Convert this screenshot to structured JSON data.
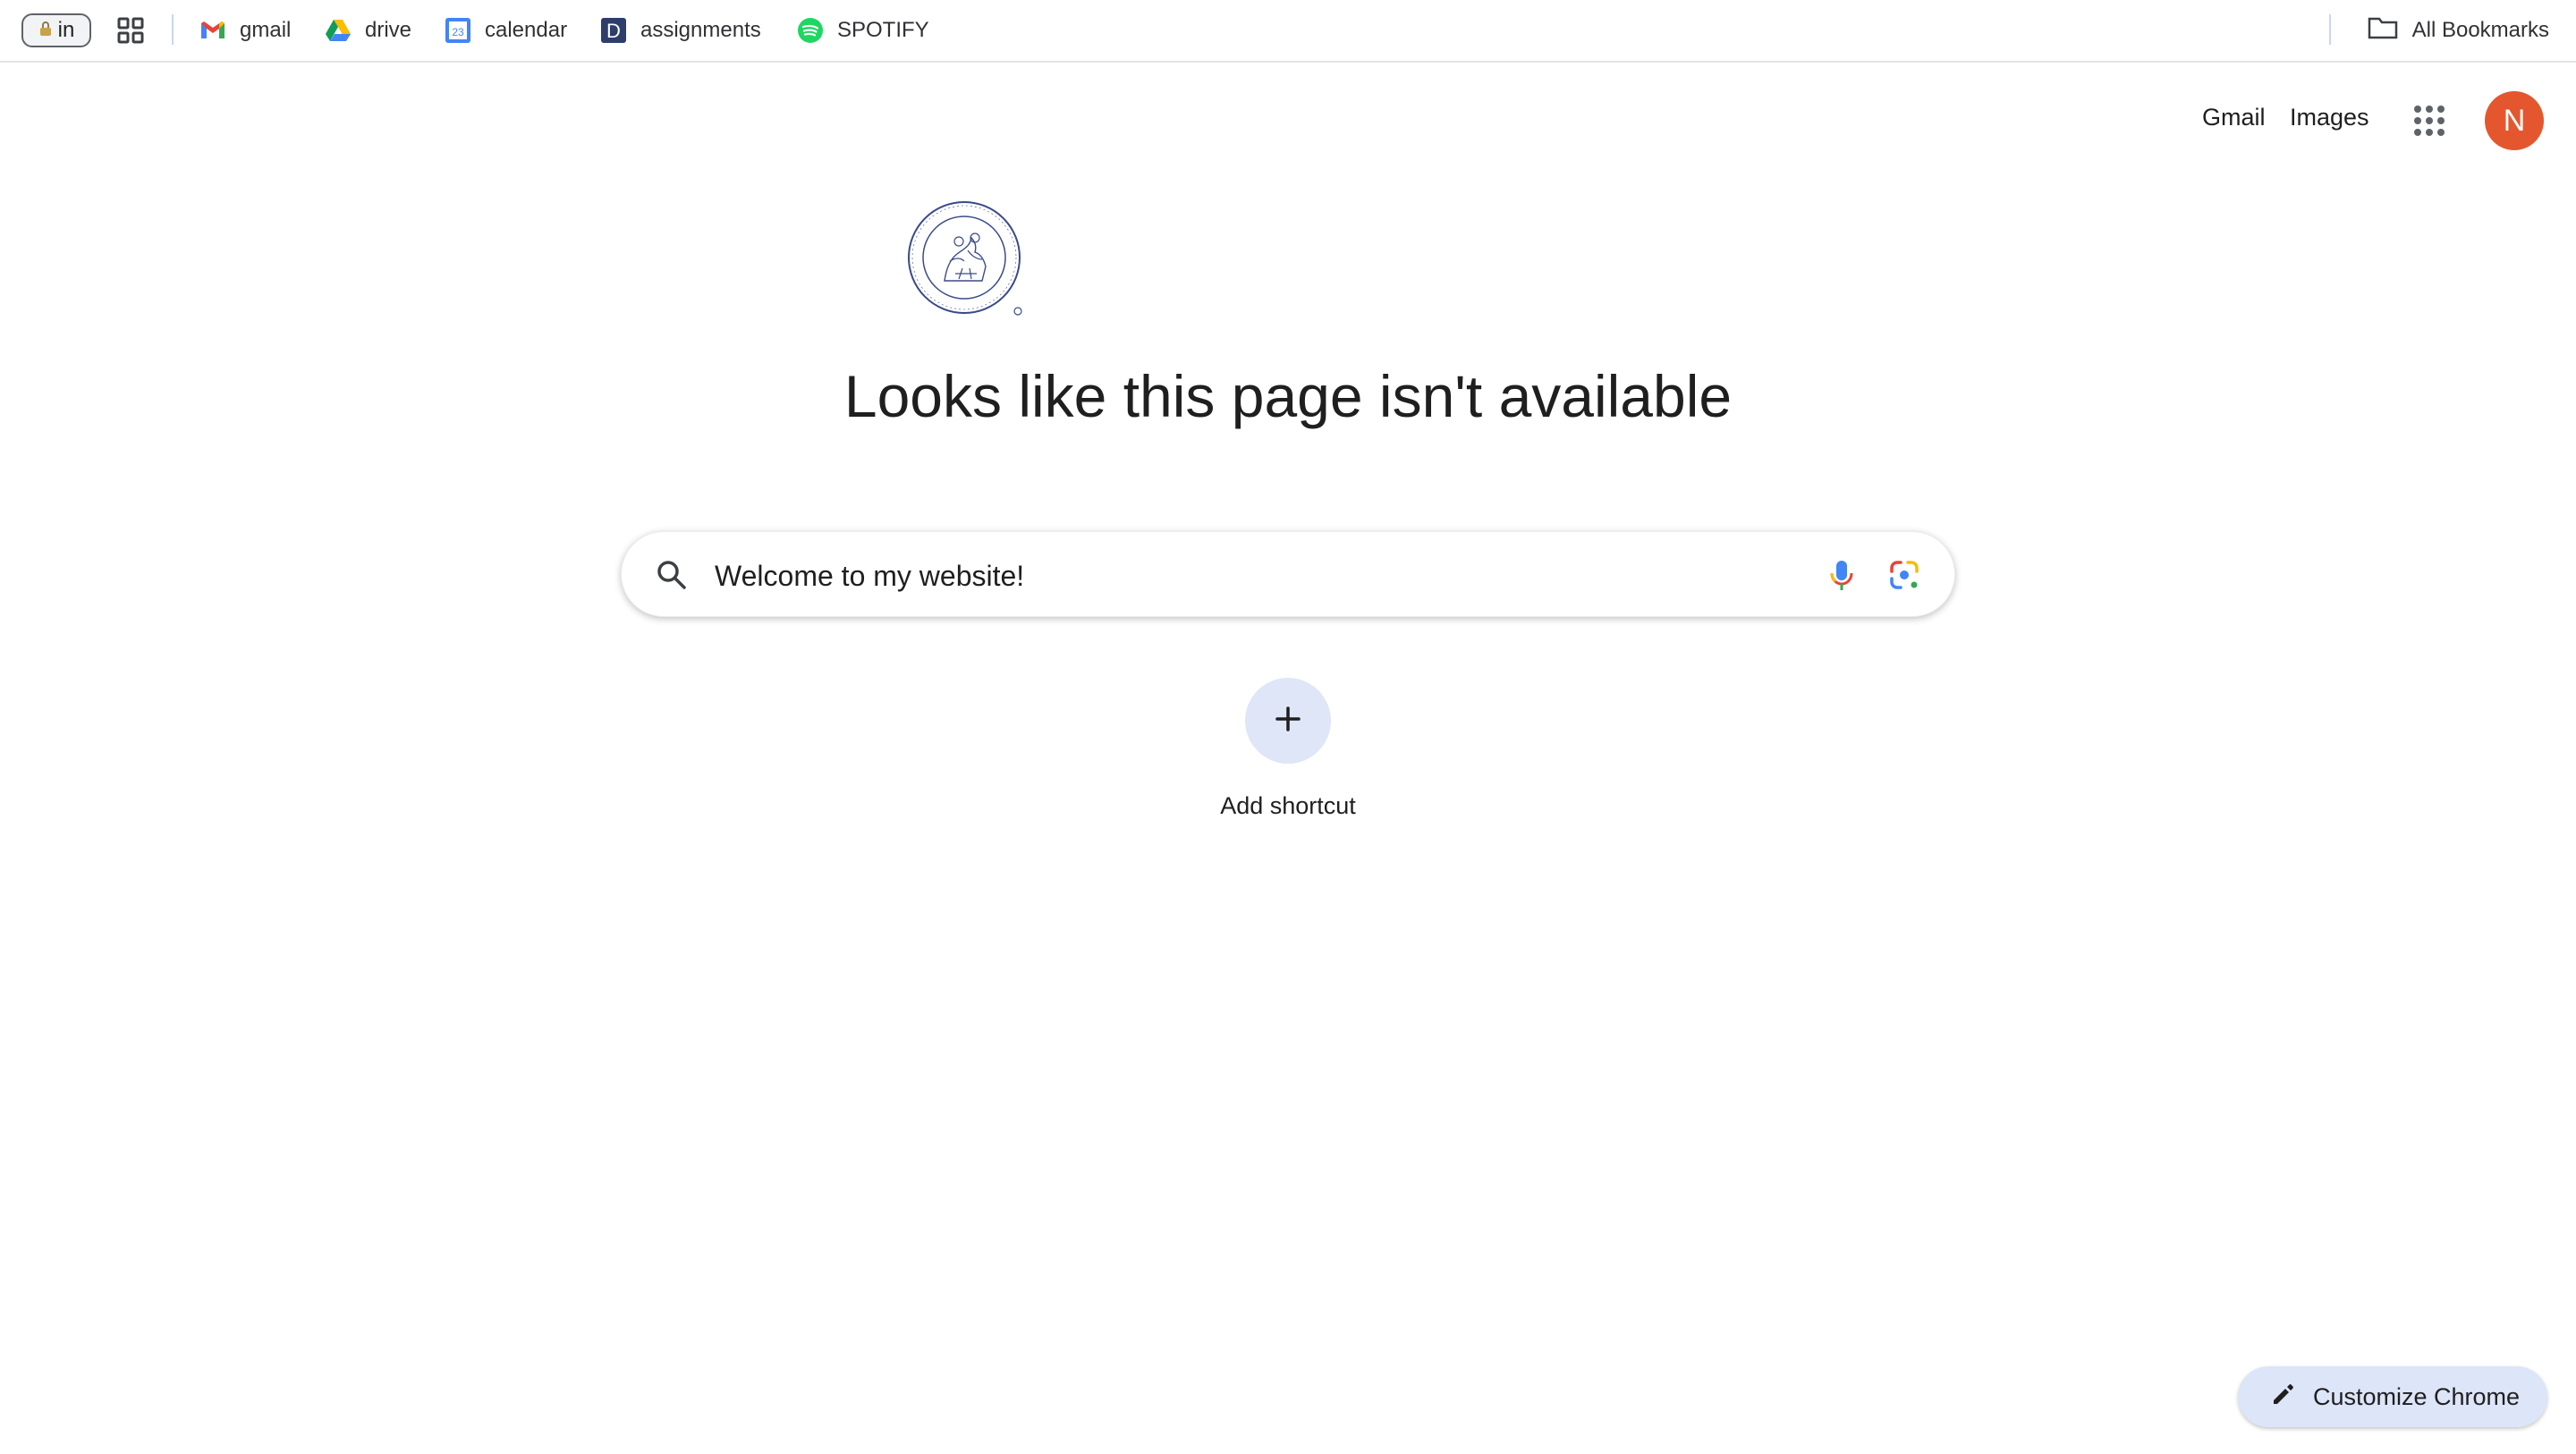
{
  "bookmarks": {
    "profile_label": "in",
    "items": [
      {
        "label": "gmail",
        "icon": "gmail-icon"
      },
      {
        "label": "drive",
        "icon": "drive-icon"
      },
      {
        "label": "calendar",
        "icon": "calendar-icon",
        "badge": "23"
      },
      {
        "label": "assignments",
        "icon": "assignments-icon",
        "badge": "D"
      },
      {
        "label": "SPOTIFY",
        "icon": "spotify-icon"
      }
    ],
    "all_label": "All Bookmarks"
  },
  "header": {
    "gmail_label": "Gmail",
    "images_label": "Images",
    "avatar_letter": "N"
  },
  "main": {
    "heading": "Looks like this page isn't available",
    "search_value": "Welcome to my website!",
    "add_shortcut_label": "Add shortcut"
  },
  "footer": {
    "customize_label": "Customize Chrome"
  },
  "colors": {
    "avatar": "#e4572e",
    "accent": "#1a73e8",
    "customize_bg": "#dde5f8"
  }
}
